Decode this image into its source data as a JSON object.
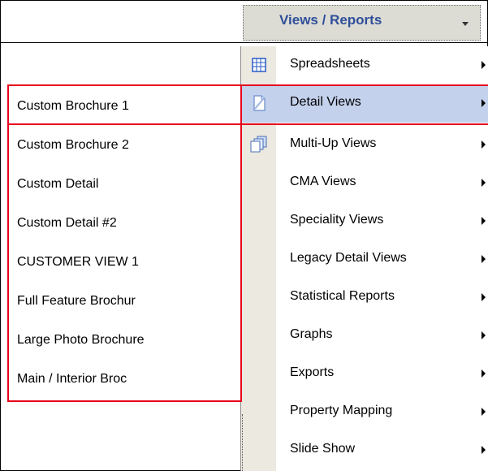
{
  "toolbar": {
    "views_reports_label": "Views / Reports"
  },
  "menu": {
    "items": [
      {
        "label": "Spreadsheets",
        "icon": "spreadsheet-icon"
      },
      {
        "label": "Detail Views",
        "icon": "document-icon",
        "highlighted": true
      },
      {
        "label": "Multi-Up Views",
        "icon": "multi-document-icon"
      },
      {
        "label": "CMA Views"
      },
      {
        "label": "Speciality Views"
      },
      {
        "label": "Legacy Detail Views"
      },
      {
        "label": "Statistical Reports"
      },
      {
        "label": "Graphs"
      },
      {
        "label": "Exports"
      },
      {
        "label": "Property Mapping"
      },
      {
        "label": "Slide Show"
      }
    ]
  },
  "submenu": {
    "items": [
      {
        "label": "Custom Brochure 1"
      },
      {
        "label": "Custom Brochure 2"
      },
      {
        "label": "Custom Detail"
      },
      {
        "label": "Custom Detail #2"
      },
      {
        "label": "CUSTOMER VIEW 1"
      },
      {
        "label": "Full Feature Brochur"
      },
      {
        "label": "Large Photo Brochure"
      },
      {
        "label": "Main / Interior Broc"
      }
    ]
  },
  "colors": {
    "highlight": "#c3d1ec",
    "annotation_red": "#e8001c",
    "toolbar_text": "#2f4f9a",
    "gutter": "#ebe9e0"
  }
}
